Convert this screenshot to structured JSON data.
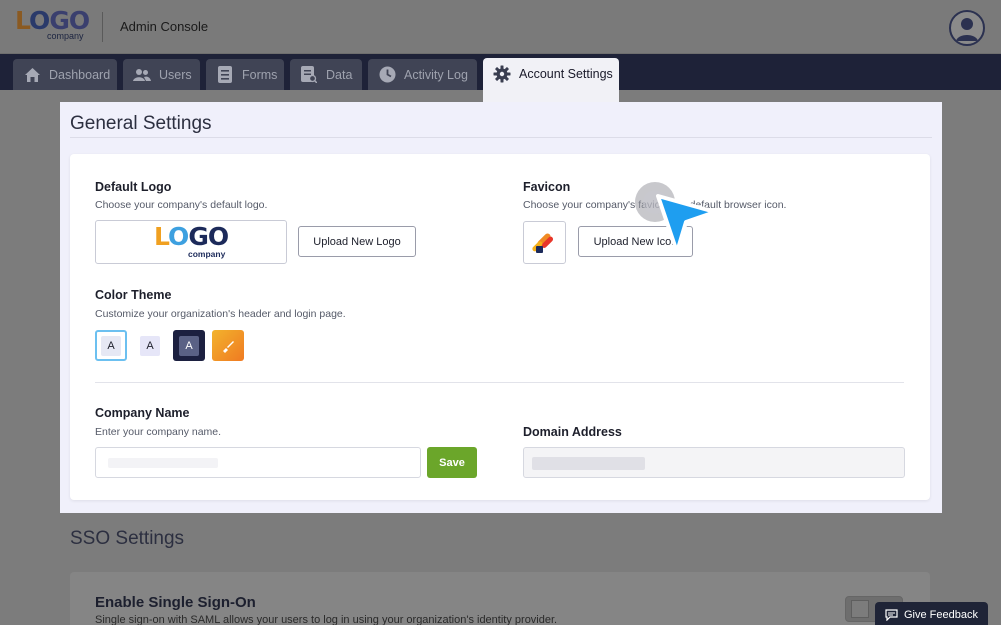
{
  "header": {
    "logo_text": "LOGO",
    "logo_sub": "company",
    "title": "Admin Console",
    "avatar_icon": "user-avatar-icon"
  },
  "nav": {
    "tabs": [
      {
        "label": "Dashboard",
        "icon": "home-icon"
      },
      {
        "label": "Users",
        "icon": "users-icon"
      },
      {
        "label": "Forms",
        "icon": "forms-icon"
      },
      {
        "label": "Data",
        "icon": "data-icon"
      },
      {
        "label": "Activity Log",
        "icon": "clock-icon"
      },
      {
        "label": "Account Settings",
        "icon": "gear-icon",
        "active": true
      }
    ]
  },
  "general": {
    "title": "General Settings",
    "default_logo": {
      "heading": "Default Logo",
      "desc": "Choose your company's default logo.",
      "preview_text": "LOGO",
      "preview_sub": "company",
      "button": "Upload New Logo"
    },
    "favicon": {
      "heading": "Favicon",
      "desc": "Choose your company's favicon, or default browser icon.",
      "button": "Upload New Icon"
    },
    "color_theme": {
      "heading": "Color Theme",
      "desc": "Customize your organization's header and login page.",
      "swatches": [
        "A",
        "A",
        "A"
      ],
      "selected_index": 0
    },
    "company_name": {
      "heading": "Company Name",
      "desc": "Enter your company name.",
      "save": "Save"
    },
    "domain": {
      "heading": "Domain Address"
    }
  },
  "sso": {
    "title": "SSO Settings",
    "card_heading": "Enable Single Sign-On",
    "card_desc": "Single sign-on with SAML allows your users to log in using your organization's identity provider."
  },
  "feedback": {
    "label": "Give Feedback"
  },
  "colors": {
    "nav_bg": "#1e2238",
    "save_green": "#6ba62a",
    "cursor_blue": "#1e9ef0"
  }
}
